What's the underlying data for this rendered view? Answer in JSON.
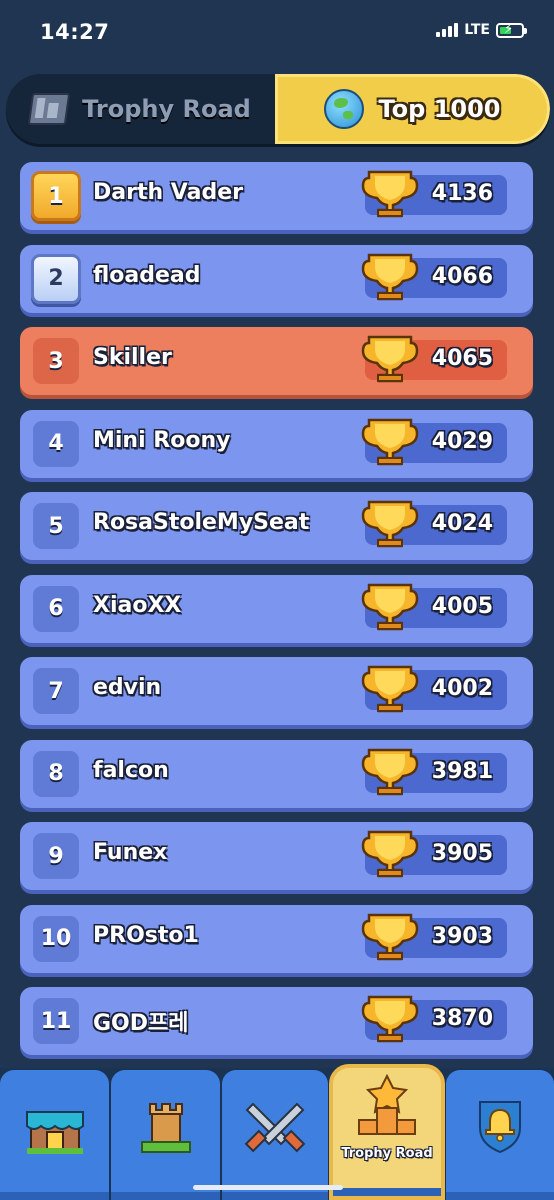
{
  "status_bar": {
    "time": "14:27",
    "network": "LTE"
  },
  "tabs": [
    {
      "label": "Trophy Road",
      "icon": "leaderboard-icon",
      "selected": false
    },
    {
      "label": "Top 1000",
      "icon": "globe-icon",
      "selected": true
    }
  ],
  "leaderboard": [
    {
      "rank": "1",
      "name": "Darth Vader",
      "trophies": "4136"
    },
    {
      "rank": "2",
      "name": "floadead",
      "trophies": "4066"
    },
    {
      "rank": "3",
      "name": "Skiller",
      "trophies": "4065"
    },
    {
      "rank": "4",
      "name": "Mini Roony",
      "trophies": "4029"
    },
    {
      "rank": "5",
      "name": "RosaStoleMySeat",
      "trophies": "4024"
    },
    {
      "rank": "6",
      "name": "XiaoXX",
      "trophies": "4005"
    },
    {
      "rank": "7",
      "name": "edvin",
      "trophies": "4002"
    },
    {
      "rank": "8",
      "name": "falcon",
      "trophies": "3981"
    },
    {
      "rank": "9",
      "name": "Funex",
      "trophies": "3905"
    },
    {
      "rank": "10",
      "name": "PROsto1",
      "trophies": "3903"
    },
    {
      "rank": "11",
      "name": "GOD프레",
      "trophies": "3870"
    }
  ],
  "nav": {
    "items": [
      {
        "icon": "shop-icon"
      },
      {
        "icon": "tower-icon"
      },
      {
        "icon": "battle-swords-icon"
      },
      {
        "icon": "trophy-road-podium-icon",
        "label": "Trophy Road",
        "active": true
      },
      {
        "icon": "clan-bell-icon"
      }
    ]
  },
  "colors": {
    "background": "#1f3551",
    "row": "#7c96ef",
    "highlight_row": "#ee7f5e",
    "tab_active": "#f2cd4a",
    "nav": "#3e7fe0"
  }
}
